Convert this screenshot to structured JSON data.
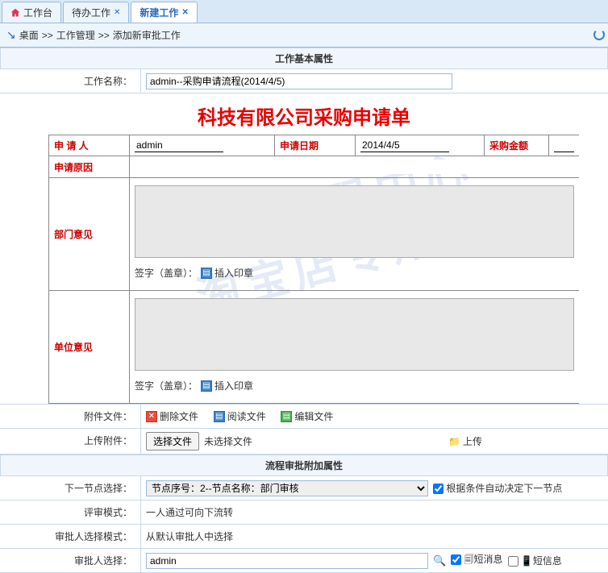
{
  "tabs": {
    "workbench": "工作台",
    "todo": "待办工作",
    "new": "新建工作"
  },
  "breadcrumb": {
    "desktop": "桌面",
    "sep": ">>",
    "mgmt": "工作管理",
    "add": "添加新审批工作"
  },
  "section1": "工作基本属性",
  "workname_label": "工作名称：",
  "workname_value": "admin--采购申请流程(2014/4/5)",
  "bigtitle": "科技有限公司采购申请单",
  "ftbl": {
    "applicant_l": "申 请 人",
    "applicant_v": "admin",
    "date_l": "申请日期",
    "date_v": "2014/4/5",
    "amount_l": "采购金额",
    "reason_l": "申请原因",
    "dept_l": "部门意见",
    "unit_l": "单位意见",
    "sign_l": "签字（盖章）：",
    "insert_seal": "插入印章"
  },
  "attach": {
    "file_l": "附件文件：",
    "del": "删除文件",
    "read": "阅读文件",
    "edit": "编辑文件",
    "upload_l": "上传附件：",
    "choose": "选择文件",
    "nofile": "未选择文件",
    "upload_btn": "上传"
  },
  "section2": "流程审批附加属性",
  "flow": {
    "next_l": "下一节点选择：",
    "next_opt": "节点序号：2--节点名称：部门审核",
    "auto": "根据条件自动决定下一节点",
    "review_l": "评审模式：",
    "review_v": "一人通过可向下流转",
    "apmode_l": "审批人选择模式：",
    "apmode_v": "从默认审批人中选择",
    "ap_l": "审批人选择：",
    "ap_v": "admin",
    "sms1": "短消息",
    "sms2": "短信息"
  },
  "watermark": "站长源码中心\n淘宝店专用图"
}
